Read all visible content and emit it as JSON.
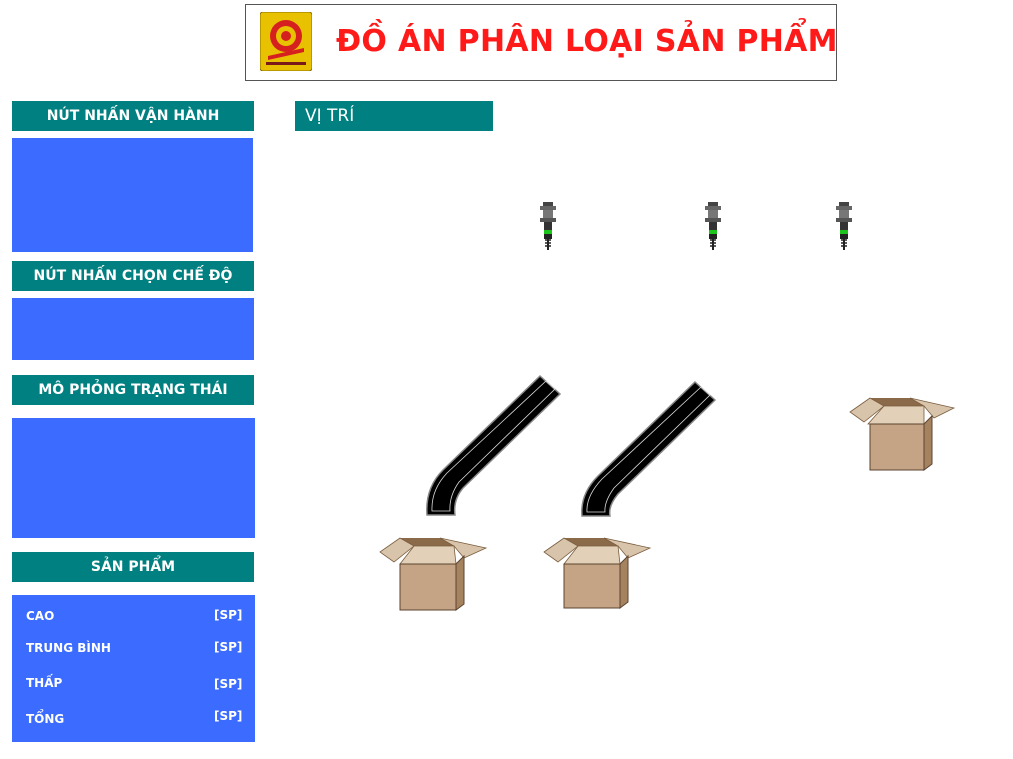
{
  "header": {
    "title": "ĐỒ ÁN PHÂN LOẠI SẢN PHẨM",
    "logo_icon": "university-logo-icon"
  },
  "sidebar": {
    "operation_buttons_title": "NÚT NHẤN VẬN HÀNH",
    "mode_buttons_title": "NÚT NHẤN CHỌN CHẾ ĐỘ",
    "status_sim_title": "MÔ PHỎNG TRẠNG THÁI",
    "products_title": "SẢN PHẨM",
    "products": [
      {
        "label": "CAO",
        "value": "[SP]"
      },
      {
        "label": "TRUNG BÌNH",
        "value": "[SP]"
      },
      {
        "label": "THẤP",
        "value": "[SP]"
      },
      {
        "label": "TỔNG",
        "value": "[SP]"
      }
    ]
  },
  "main": {
    "position_title": "VỊ TRÍ",
    "sensors": [
      "proximity-sensor-icon",
      "proximity-sensor-icon",
      "proximity-sensor-icon"
    ],
    "chutes": [
      "chute-icon",
      "chute-icon"
    ],
    "boxes": [
      "cardboard-box-icon",
      "cardboard-box-icon",
      "cardboard-box-icon"
    ]
  },
  "colors": {
    "header_teal": "#008080",
    "panel_blue": "#3b6cff",
    "title_red": "#ff1a1a",
    "box_brown": "#c4a484"
  }
}
